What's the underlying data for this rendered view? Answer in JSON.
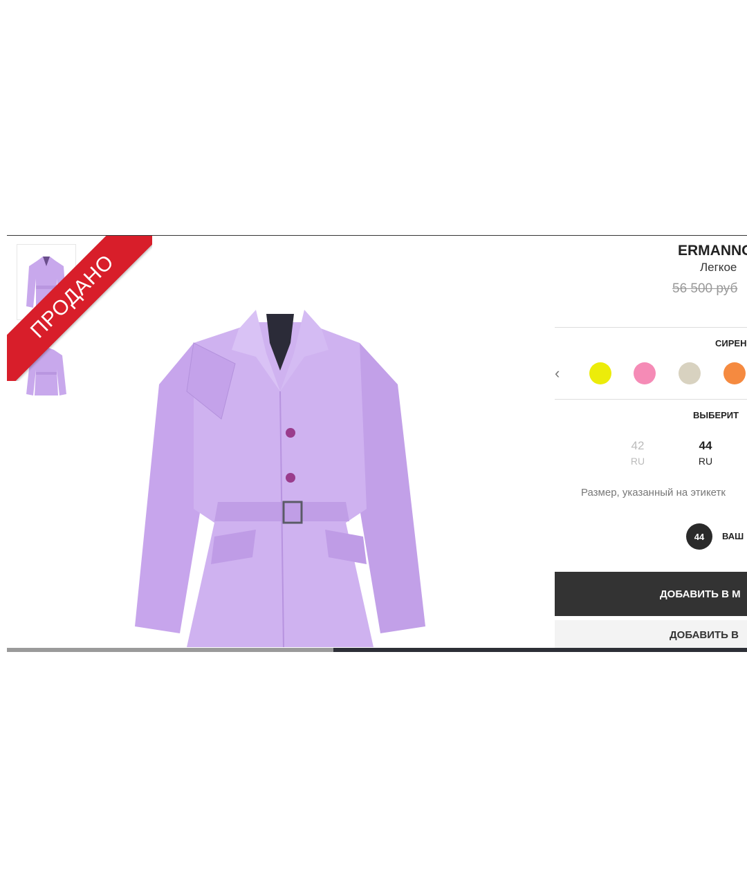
{
  "ribbon": {
    "text": "ПРОДАНО",
    "color": "#d81e2a"
  },
  "product": {
    "brand": "ERMANNO",
    "subtitle": "Легкое",
    "old_price": "56 500 руб"
  },
  "colors": {
    "label": "СИРЕН",
    "prev_icon": "chevron-left-icon",
    "prev_glyph": "‹",
    "swatches": [
      {
        "name": "yellow",
        "hex": "#ecec0a"
      },
      {
        "name": "pink",
        "hex": "#f58bb6"
      },
      {
        "name": "beige",
        "hex": "#d8d2c0"
      },
      {
        "name": "orange",
        "hex": "#f58a40"
      }
    ]
  },
  "sizes": {
    "label": "ВЫБЕРИТ",
    "options": [
      {
        "value": "42",
        "system": "RU",
        "state": "unavailable"
      },
      {
        "value": "44",
        "system": "RU",
        "state": "selected"
      }
    ],
    "note": "Размер, указанный на этикетк",
    "your_size": {
      "badge": "44",
      "text": "ВАШ"
    }
  },
  "actions": {
    "add_to_cart": "ДОБАВИТЬ В М",
    "add_to_wishlist": "ДОБАВИТЬ В"
  },
  "product_color": "#c8a8ec"
}
